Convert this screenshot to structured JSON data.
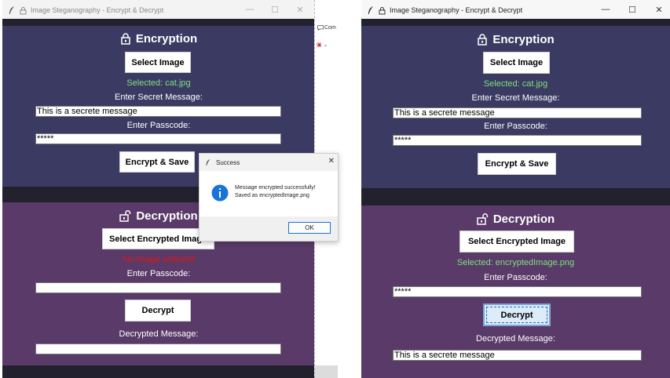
{
  "left_window": {
    "title": "Image Steganography - Encrypt & Decrypt",
    "encryption": {
      "heading": "Encryption",
      "select_button": "Select Image",
      "selected_text": "Selected: cat.jpg",
      "secret_label": "Enter Secret Message:",
      "secret_value": "This is a secrete message",
      "passcode_label": "Enter Passcode:",
      "passcode_value": "*****",
      "encrypt_button": "Encrypt & Save"
    },
    "decryption": {
      "heading": "Decryption",
      "select_button": "Select Encrypted Image",
      "selected_text": "No image selected",
      "passcode_label": "Enter Passcode:",
      "passcode_value": "",
      "decrypt_button": "Decrypt",
      "message_label": "Decrypted Message:",
      "message_value": ""
    }
  },
  "background_app": {
    "comment_label": "Com"
  },
  "dialog": {
    "title": "Success",
    "line1": "Message encrypted successfully!",
    "line2": "Saved as encryptedImage.png",
    "ok_button": "OK"
  },
  "right_window": {
    "title": "Image Steganography - Encrypt & Decrypt",
    "encryption": {
      "heading": "Encryption",
      "select_button": "Select Image",
      "selected_text": "Selected: cat.jpg",
      "secret_label": "Enter Secret Message:",
      "secret_value": "This is a secrete message",
      "passcode_label": "Enter Passcode:",
      "passcode_value": "*****",
      "encrypt_button": "Encrypt & Save"
    },
    "decryption": {
      "heading": "Decryption",
      "select_button": "Select Encrypted Image",
      "selected_text": "Selected: encryptedImage.png",
      "passcode_label": "Enter Passcode:",
      "passcode_value": "*****",
      "decrypt_button": "Decrypt",
      "message_label": "Decrypted Message:",
      "message_value": "This is a secrete message"
    }
  },
  "colors": {
    "encryption_bg": "#3b3a63",
    "decryption_bg": "#5a3a68",
    "divider": "#22212d",
    "selected_green": "#7ee07e",
    "error_red": "#e01515",
    "info_blue": "#1a73d9"
  },
  "window_controls": {
    "minimize": "—",
    "maximize": "☐",
    "close": "✕"
  }
}
